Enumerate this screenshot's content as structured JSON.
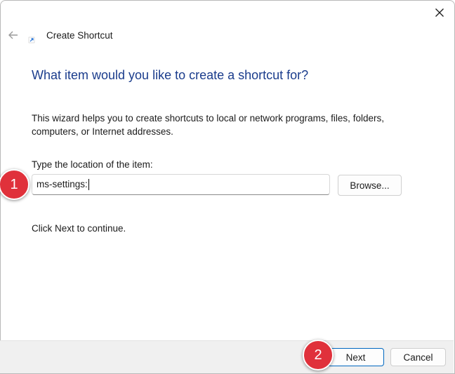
{
  "window": {
    "title": "Create Shortcut",
    "close_icon": "close-icon",
    "back_icon": "back-arrow-icon",
    "wizard_icon": "shortcut-icon"
  },
  "main": {
    "heading": "What item would you like to create a shortcut for?",
    "description": "This wizard helps you to create shortcuts to local or network programs, files, folders, computers, or Internet addresses.",
    "location_label": "Type the location of the item:",
    "location_value": "ms-settings:",
    "browse_label": "Browse...",
    "continue_text": "Click Next to continue."
  },
  "footer": {
    "next_label": "Next",
    "cancel_label": "Cancel"
  },
  "annotations": [
    {
      "label": "1"
    },
    {
      "label": "2"
    }
  ],
  "colors": {
    "heading": "#1a3c8c",
    "marker": "#e0313b",
    "primary_button_border": "#0067c0"
  }
}
